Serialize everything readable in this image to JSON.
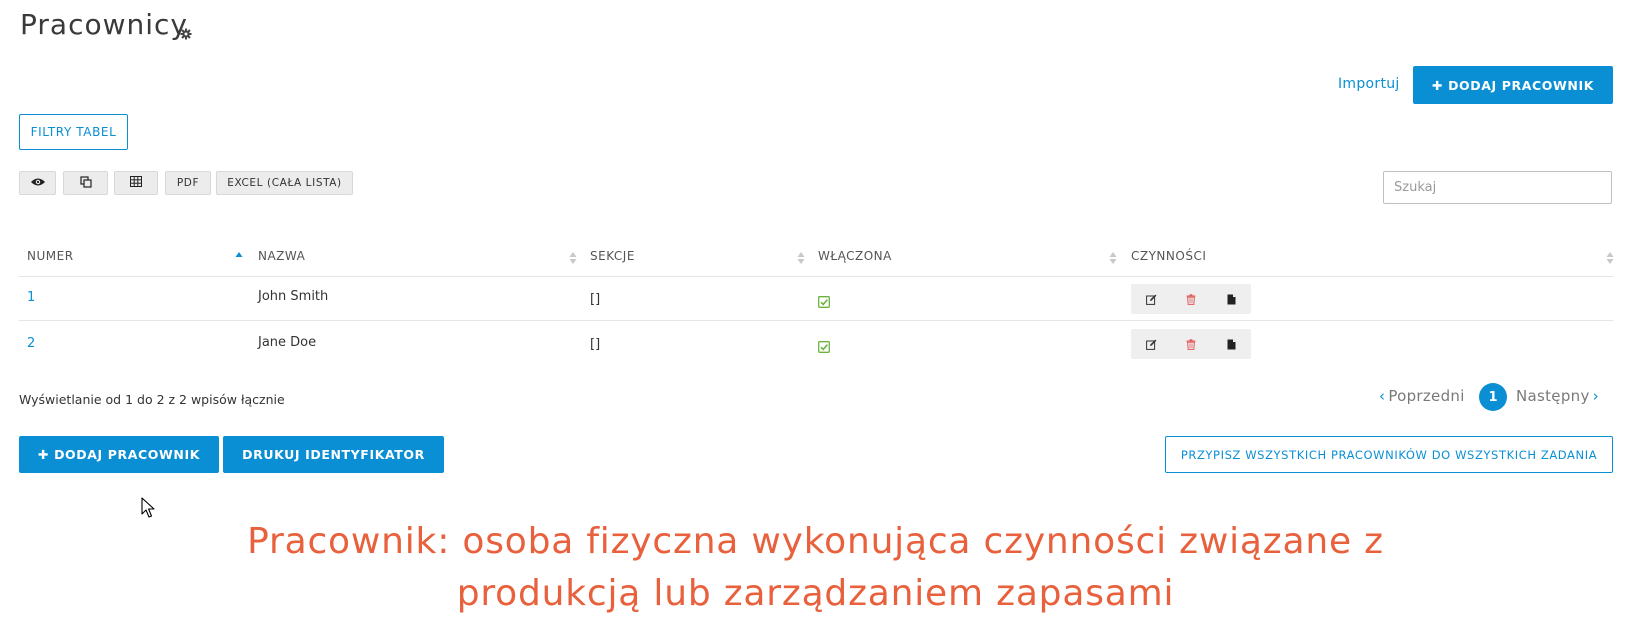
{
  "page": {
    "title": "Pracownicy",
    "title_icon": "gear-icon"
  },
  "top_actions": {
    "import_label": "Importuj",
    "add_employee_label": "DODAJ PRACOWNIK"
  },
  "filters": {
    "label": "FILTRY TABEL"
  },
  "toolbar": {
    "buttons": [
      {
        "name": "visibility",
        "icon": "eye-icon",
        "label": ""
      },
      {
        "name": "copy",
        "icon": "copy-icon",
        "label": ""
      },
      {
        "name": "table",
        "icon": "table-icon",
        "label": ""
      },
      {
        "name": "pdf",
        "icon": "",
        "label": "PDF"
      },
      {
        "name": "excel",
        "icon": "",
        "label": "EXCEL (CAŁA LISTA)"
      }
    ]
  },
  "search": {
    "placeholder": "Szukaj",
    "value": ""
  },
  "table": {
    "columns": [
      "NUMER",
      "NAZWA",
      "SEKCJE",
      "WŁĄCZONA",
      "CZYNNOŚCI"
    ],
    "sorted_column": "NUMER",
    "sort_direction": "asc",
    "rows": [
      {
        "number": "1",
        "name": "John Smith",
        "sections": "[]",
        "enabled": true
      },
      {
        "number": "2",
        "name": "Jane Doe",
        "sections": "[]",
        "enabled": true
      }
    ],
    "row_actions": [
      "edit-icon",
      "trash-icon",
      "document-icon"
    ]
  },
  "info": {
    "text": "Wyświetlanie od 1 do 2 z 2 wpisów łącznie"
  },
  "pagination": {
    "prev_label": "Poprzedni",
    "current_page": "1",
    "next_label": "Następny"
  },
  "bottom_actions": {
    "add_employee_label": "DODAJ PRACOWNIK",
    "print_id_label": "DRUKUJ IDENTYFIKATOR",
    "assign_all_label": "PRZYPISZ WSZYSTKICH PRACOWNIKÓW DO WSZYSTKICH ZADANIA"
  },
  "caption": {
    "line1": "Pracownik: osoba fizyczna wykonująca czynności związane z",
    "line2": "produkcją lub zarządzaniem zapasami"
  },
  "colors": {
    "accent": "#0b8fd4",
    "caption": "#e8603c",
    "success": "#6cb33f",
    "danger": "#e05c5c"
  }
}
